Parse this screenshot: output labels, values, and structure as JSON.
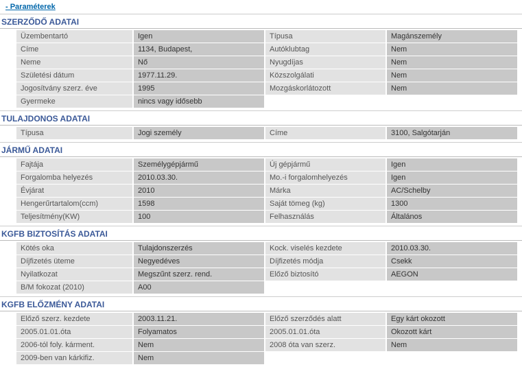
{
  "paramLink": "- Paraméterek",
  "sections": [
    {
      "title": "SZERZŐDŐ ADATAI",
      "rows": [
        {
          "l1": "Üzembentartó",
          "v1": "Igen",
          "l2": "Típusa",
          "v2": "Magánszemély"
        },
        {
          "l1": "Címe",
          "v1": "1134, Budapest,",
          "l2": "Autóklubtag",
          "v2": "Nem"
        },
        {
          "l1": "Neme",
          "v1": "Nő",
          "l2": "Nyugdíjas",
          "v2": "Nem"
        },
        {
          "l1": "Születési dátum",
          "v1": "1977.11.29.",
          "l2": "Közszolgálati",
          "v2": "Nem"
        },
        {
          "l1": "Jogosítvány szerz. éve",
          "v1": "1995",
          "l2": "Mozgáskorlátozott",
          "v2": "Nem"
        },
        {
          "l1": "Gyermeke",
          "v1": "nincs vagy idősebb",
          "l2": "",
          "v2": ""
        }
      ]
    },
    {
      "title": "TULAJDONOS ADATAI",
      "rows": [
        {
          "l1": "Típusa",
          "v1": "Jogi személy",
          "l2": "Címe",
          "v2": "3100, Salgótarján"
        }
      ]
    },
    {
      "title": "JÁRMŰ ADATAI",
      "rows": [
        {
          "l1": "Fajtája",
          "v1": "Személygépjármű",
          "l2": "Új gépjármű",
          "v2": "Igen"
        },
        {
          "l1": "Forgalomba helyezés",
          "v1": "2010.03.30.",
          "l2": "Mo.-i forgalomhelyezés",
          "v2": "Igen"
        },
        {
          "l1": "Évjárat",
          "v1": "2010",
          "l2": "Márka",
          "v2": "AC/Schelby"
        },
        {
          "l1": "Hengerűrtartalom(ccm)",
          "v1": "1598",
          "l2": "Saját tömeg (kg)",
          "v2": "1300"
        },
        {
          "l1": "Teljesítmény(KW)",
          "v1": "100",
          "l2": "Felhasználás",
          "v2": "Általános"
        }
      ]
    },
    {
      "title": "KGFB BIZTOSÍTÁS ADATAI",
      "rows": [
        {
          "l1": "Kötés oka",
          "v1": "Tulajdonszerzés",
          "l2": "Kock. viselés kezdete",
          "v2": "2010.03.30."
        },
        {
          "l1": "Díjfizetés üteme",
          "v1": "Negyedéves",
          "l2": "Díjfizetés módja",
          "v2": "Csekk"
        },
        {
          "l1": "Nyilatkozat",
          "v1": "Megszűnt szerz. rend.",
          "l2": "Előző biztosító",
          "v2": "AEGON"
        },
        {
          "l1": "B/M fokozat (2010)",
          "v1": "A00",
          "l2": "",
          "v2": ""
        }
      ]
    },
    {
      "title": "KGFB ELŐZMÉNY ADATAI",
      "rows": [
        {
          "l1": "Előző szerz. kezdete",
          "v1": "2003.11.21.",
          "l2": "Előző szerződés alatt",
          "v2": "Egy kárt okozott"
        },
        {
          "l1": "2005.01.01.óta",
          "v1": "Folyamatos",
          "l2": "2005.01.01.óta",
          "v2": "Okozott kárt"
        },
        {
          "l1": "2006-tól foly. kárment.",
          "v1": "Nem",
          "l2": "2008 óta van szerz.",
          "v2": "Nem"
        },
        {
          "l1": "2009-ben van kárkifiz.",
          "v1": "Nem",
          "l2": "",
          "v2": ""
        }
      ]
    }
  ]
}
